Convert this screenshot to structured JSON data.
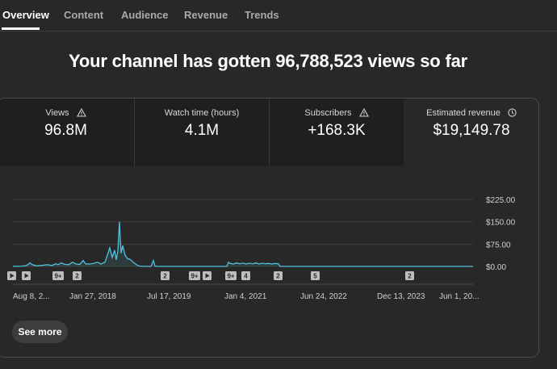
{
  "tabs": [
    {
      "label": "Overview",
      "active": true
    },
    {
      "label": "Content",
      "active": false
    },
    {
      "label": "Audience",
      "active": false
    },
    {
      "label": "Revenue",
      "active": false
    },
    {
      "label": "Trends",
      "active": false
    }
  ],
  "headline": "Your channel has gotten 96,788,523 views so far",
  "metrics": [
    {
      "label": "Views",
      "value": "96.8M",
      "icon": "warning-icon"
    },
    {
      "label": "Watch time (hours)",
      "value": "4.1M",
      "icon": ""
    },
    {
      "label": "Subscribers",
      "value": "+168.3K",
      "icon": "warning-icon"
    },
    {
      "label": "Estimated revenue",
      "value": "$19,149.78",
      "icon": "clock-icon"
    }
  ],
  "chart_data": {
    "type": "line",
    "series": [
      {
        "name": "",
        "color": "#4fc3e0"
      }
    ],
    "y_ticks": [
      "$225.00",
      "$150.00",
      "$75.00",
      "$0.00"
    ],
    "ylim": [
      0,
      225
    ],
    "x_ticks": [
      "Aug 8, 2...",
      "Jan 27, 2018",
      "Jul 17, 2019",
      "Jan 4, 2021",
      "Jun 24, 2022",
      "Dec 13, 2023",
      "Jun 1, 20..."
    ],
    "markers": [
      {
        "kind": "play"
      },
      {
        "kind": "play"
      },
      {
        "kind": "text",
        "label": "9+"
      },
      {
        "kind": "text",
        "label": "2"
      },
      {
        "kind": "text",
        "label": "2"
      },
      {
        "kind": "text",
        "label": "9+"
      },
      {
        "kind": "play"
      },
      {
        "kind": "text",
        "label": "9+"
      },
      {
        "kind": "text",
        "label": "4"
      },
      {
        "kind": "text",
        "label": "2"
      },
      {
        "kind": "text",
        "label": "5"
      },
      {
        "kind": "text",
        "label": "2"
      }
    ],
    "grid": true
  },
  "see_more": "See more"
}
